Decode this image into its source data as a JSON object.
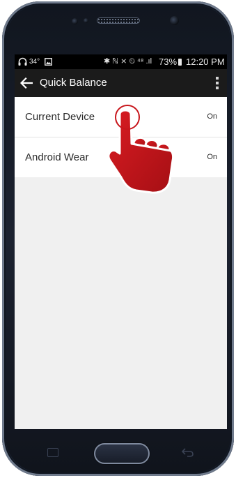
{
  "status_bar": {
    "temperature": "34°",
    "icons": "✱ ℕ ⨯ ⏲ ⁴⁸ .ıl",
    "battery_pct": "73%",
    "time": "12:20 PM"
  },
  "app_bar": {
    "title": "Quick Balance",
    "back_icon": "arrow-left-icon",
    "menu_icon": "overflow-menu-icon"
  },
  "settings": [
    {
      "label": "Current Device",
      "value": "On"
    },
    {
      "label": "Android Wear",
      "value": "On"
    }
  ],
  "overlay": {
    "gesture": "tap",
    "color": "#c8161c"
  },
  "colors": {
    "app_bar": "#1b1b1b",
    "status_bar": "#000000",
    "screen_background": "#f0f0f0",
    "list_background": "#ffffff"
  }
}
